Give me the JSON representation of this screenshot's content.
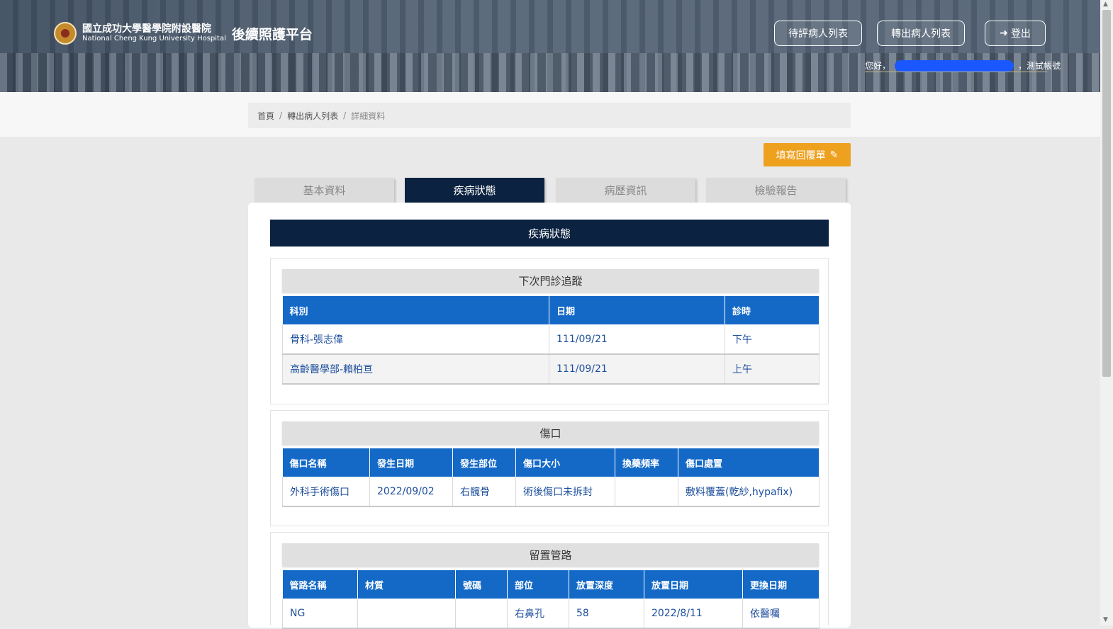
{
  "header": {
    "hospital_cn": "國立成功大學醫學院附設醫院",
    "hospital_en": "National Cheng Kung University Hospital",
    "platform_title": "後續照護平台",
    "buttons": {
      "pending_list": "待評病人列表",
      "transfer_list": "轉出病人列表",
      "logout": "登出"
    },
    "greeting": "您好，",
    "account": "，測試帳號"
  },
  "breadcrumb": {
    "home": "首頁",
    "transfer_list": "轉出病人列表",
    "current": "詳細資料",
    "separator": "/"
  },
  "reply_button": "填寫回覆單",
  "tabs": [
    "基本資料",
    "疾病狀態",
    "病歷資訊",
    "檢驗報告"
  ],
  "active_tab": "疾病狀態",
  "card_title": "疾病狀態",
  "followup": {
    "title": "下次門診追蹤",
    "columns": [
      "科別",
      "日期",
      "診時"
    ],
    "rows": [
      [
        "骨科-張志偉",
        "111/09/21",
        "下午"
      ],
      [
        "高齡醫學部-賴柏亘",
        "111/09/21",
        "上午"
      ]
    ]
  },
  "wound": {
    "title": "傷口",
    "columns": [
      "傷口名稱",
      "發生日期",
      "發生部位",
      "傷口大小",
      "換藥頻率",
      "傷口處置"
    ],
    "rows": [
      [
        "外科手術傷口",
        "2022/09/02",
        "右髖骨",
        "術後傷口未拆封",
        "",
        "敷料覆蓋(乾紗,hypafix)"
      ]
    ]
  },
  "tubes": {
    "title": "留置管路",
    "columns": [
      "管路名稱",
      "材質",
      "號碼",
      "部位",
      "放置深度",
      "放置日期",
      "更換日期"
    ],
    "rows": [
      [
        "NG",
        "",
        "",
        "右鼻孔",
        "58",
        "2022/8/11",
        "依醫囑"
      ]
    ]
  },
  "colors": {
    "navy": "#0b2240",
    "table_header": "#1469c7",
    "accent_orange": "#eea11f",
    "masked_name": "#1a57ff"
  }
}
